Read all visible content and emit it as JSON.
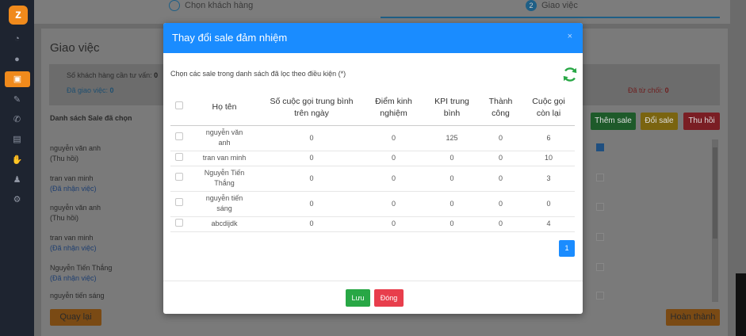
{
  "logo_text": "z",
  "sidebar": {
    "items": [
      {
        "icon": "dashboard-icon",
        "glyph": "◔"
      },
      {
        "icon": "user-icon",
        "glyph": "●"
      },
      {
        "icon": "briefcase-icon",
        "glyph": "▣",
        "active": true
      },
      {
        "icon": "edit-icon",
        "glyph": "✎"
      },
      {
        "icon": "phone-icon",
        "glyph": "✆"
      },
      {
        "icon": "chart-icon",
        "glyph": "▤"
      },
      {
        "icon": "hand-icon",
        "glyph": "✋"
      },
      {
        "icon": "users-icon",
        "glyph": "♟"
      },
      {
        "icon": "gear-icon",
        "glyph": "⚙"
      }
    ]
  },
  "stepper": {
    "step1_label": "Chọn khách hàng",
    "step2_num": "2",
    "step2_label": "Giao việc"
  },
  "page": {
    "title": "Giao việc",
    "stats": {
      "customers_label": "Số khách hàng cần tư vấn:",
      "customers_value": "0",
      "assigned_label": "Đã giao việc:",
      "assigned_value": "0",
      "rejected_label": "Đã từ chối:",
      "rejected_value": "0"
    },
    "selected_title": "Danh sách Sale đã chọn",
    "selected_sales": [
      {
        "name": "nguyễn văn anh",
        "status": "(Thu hồi)"
      },
      {
        "name": "tran van minh",
        "status": "(Đã nhận việc)"
      },
      {
        "name": "nguyễn văn anh",
        "status": "(Thu hồi)"
      },
      {
        "name": "tran van minh",
        "status": "(Đã nhận việc)"
      },
      {
        "name": "Nguyễn Tiến Thắng",
        "status": "(Đã nhận việc)"
      },
      {
        "name": "nguyễn tiến sáng",
        "status": ""
      }
    ],
    "buttons": {
      "add": "Thêm sale",
      "change": "Đổi sale",
      "revoke": "Thu hồi",
      "back": "Quay lại",
      "finish": "Hoàn thành"
    }
  },
  "modal": {
    "title": "Thay đổi sale đảm nhiệm",
    "close_glyph": "×",
    "description": "Chọn các sale trong danh sách đã lọc theo điều kiện (*)",
    "columns": [
      "Họ tên",
      "Số cuộc gọi trung bình trên ngày",
      "Điểm kinh nghiệm",
      "KPI trung bình",
      "Thành công",
      "Cuộc gọi còn lại"
    ],
    "rows": [
      {
        "name": "nguyễn văn anh",
        "calls_per_day": "0",
        "experience": "0",
        "kpi": "125",
        "success": "0",
        "remaining": "6"
      },
      {
        "name": "tran van minh",
        "calls_per_day": "0",
        "experience": "0",
        "kpi": "0",
        "success": "0",
        "remaining": "10"
      },
      {
        "name": "Nguyễn Tiến Thắng",
        "calls_per_day": "0",
        "experience": "0",
        "kpi": "0",
        "success": "0",
        "remaining": "3"
      },
      {
        "name": "nguyễn tiến sáng",
        "calls_per_day": "0",
        "experience": "0",
        "kpi": "0",
        "success": "0",
        "remaining": "0"
      },
      {
        "name": "abcdijdk",
        "calls_per_day": "0",
        "experience": "0",
        "kpi": "0",
        "success": "0",
        "remaining": "4"
      }
    ],
    "pagination": {
      "current": "1"
    },
    "save_label": "Lưu",
    "close_label": "Đóng"
  }
}
